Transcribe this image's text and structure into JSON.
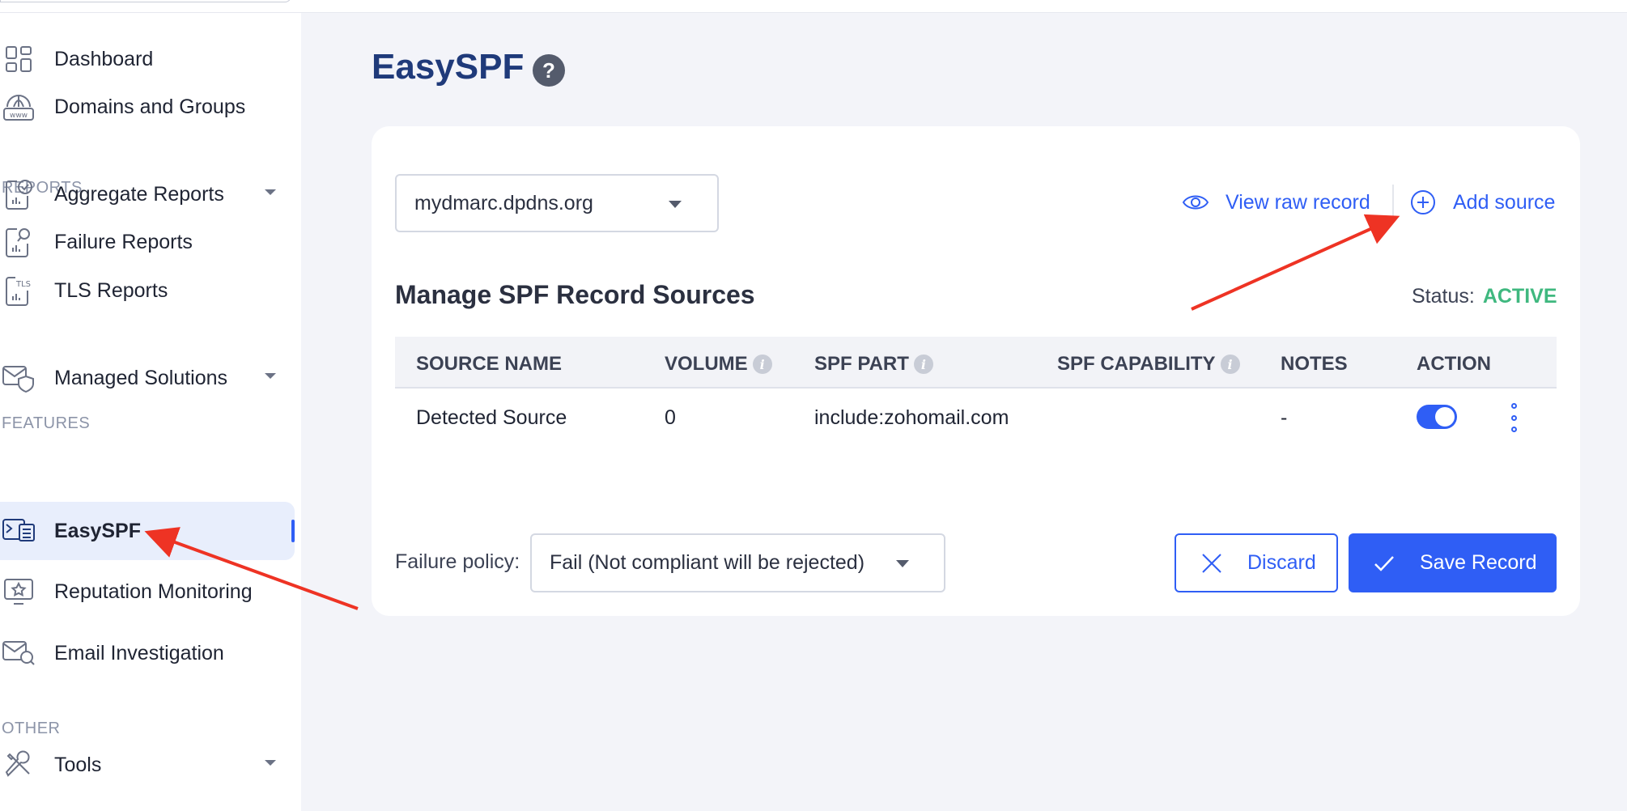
{
  "sidebar": {
    "sections": {
      "reports": "REPORTS",
      "features": "FEATURES",
      "other": "OTHER"
    },
    "items": {
      "dashboard": {
        "label": "Dashboard",
        "icon": "dashboard-grid-icon"
      },
      "domains": {
        "label": "Domains and Groups",
        "icon": "www-globe-icon"
      },
      "aggregate": {
        "label": "Aggregate Reports",
        "icon": "report-check-icon"
      },
      "failure": {
        "label": "Failure Reports",
        "icon": "report-search-icon"
      },
      "tls": {
        "label": "TLS Reports",
        "icon": "tls-report-icon"
      },
      "managed": {
        "label": "Managed Solutions",
        "icon": "shield-mail-icon"
      },
      "easyspf": {
        "label": "EasySPF",
        "icon": "spf-list-icon",
        "active": true
      },
      "reputation": {
        "label": "Reputation Monitoring",
        "icon": "star-monitor-icon"
      },
      "investigation": {
        "label": "Email Investigation",
        "icon": "mail-search-icon"
      },
      "tools": {
        "label": "Tools",
        "icon": "tools-icon"
      }
    }
  },
  "main": {
    "title": "EasySPF",
    "help_label": "?",
    "domain_select": {
      "value": "mydmarc.dpdns.org"
    },
    "actions": {
      "view_raw": "View raw record",
      "add_source": "Add source"
    },
    "section_title": "Manage SPF Record Sources",
    "status": {
      "label": "Status:",
      "value": "ACTIVE"
    },
    "table": {
      "headers": {
        "source_name": "SOURCE NAME",
        "volume": "VOLUME",
        "spf_part": "SPF PART",
        "spf_capability": "SPF CAPABILITY",
        "notes": "NOTES",
        "action": "ACTION"
      },
      "info_glyph": "i",
      "rows": [
        {
          "source_name": "Detected Source",
          "volume": "0",
          "spf_part": "include:zohomail.com",
          "spf_capability": "",
          "notes": "-",
          "enabled": true
        }
      ]
    },
    "failure_policy": {
      "label": "Failure policy:",
      "value": "Fail (Not compliant will be rejected)"
    },
    "buttons": {
      "discard": "Discard",
      "save": "Save Record"
    }
  },
  "colors": {
    "accent": "#2f5ef5",
    "title": "#1f3a7a",
    "status_active": "#3fb87f",
    "annotation_arrow": "#ee3324"
  }
}
